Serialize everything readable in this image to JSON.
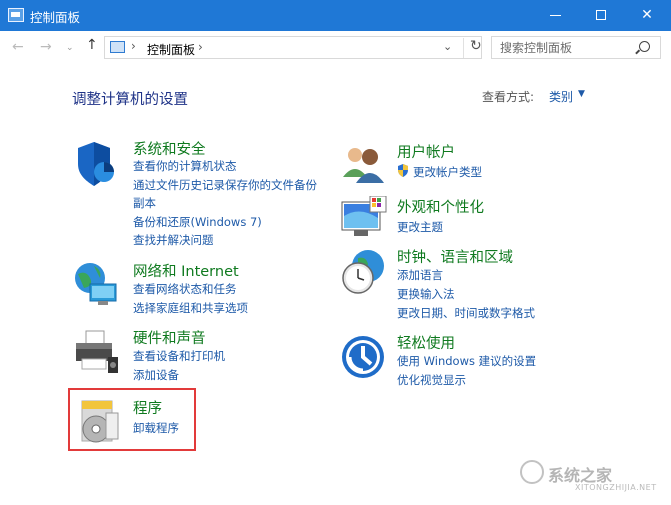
{
  "window": {
    "title": "控制面板",
    "controls": {
      "minimize": "—",
      "maximize": "☐",
      "close": "✕"
    }
  },
  "addressbar": {
    "breadcrumb": "控制面板",
    "separator": "›",
    "search_placeholder": "搜索控制面板"
  },
  "main": {
    "heading": "调整计算机的设置",
    "view_by_label": "查看方式:",
    "view_by_value": "类别",
    "categories": [
      {
        "title": "系统和安全",
        "icon": "shield-icon",
        "links": [
          "查看你的计算机状态",
          "通过文件历史记录保存你的文件备份",
          "副本",
          "备份和还原(Windows 7)",
          "查找并解决问题"
        ]
      },
      {
        "title": "网络和 Internet",
        "icon": "network-globe-icon",
        "links": [
          "查看网络状态和任务",
          "选择家庭组和共享选项"
        ]
      },
      {
        "title": "硬件和声音",
        "icon": "printer-icon",
        "links": [
          "查看设备和打印机",
          "添加设备"
        ]
      },
      {
        "title": "程序",
        "icon": "programs-disc-icon",
        "links": [
          "卸载程序"
        ]
      },
      {
        "title": "用户帐户",
        "icon": "users-icon",
        "links": [
          "更改帐户类型"
        ]
      },
      {
        "title": "外观和个性化",
        "icon": "monitor-palette-icon",
        "links": [
          "更改主题"
        ]
      },
      {
        "title": "时钟、语言和区域",
        "icon": "clock-globe-icon",
        "links": [
          "添加语言",
          "更换输入法",
          "更改日期、时间或数字格式"
        ]
      },
      {
        "title": "轻松使用",
        "icon": "ease-of-access-icon",
        "links": [
          "使用 Windows 建议的设置",
          "优化视觉显示"
        ]
      }
    ]
  },
  "watermark": {
    "text": "系统之家",
    "sub": "XITONGZHIJIA.NET"
  },
  "colors": {
    "titlebar": "#1f78d6",
    "category_title": "#0f7a1f",
    "link": "#1e5aa8",
    "heading": "#1e3287",
    "highlight": "#e23a3a"
  }
}
